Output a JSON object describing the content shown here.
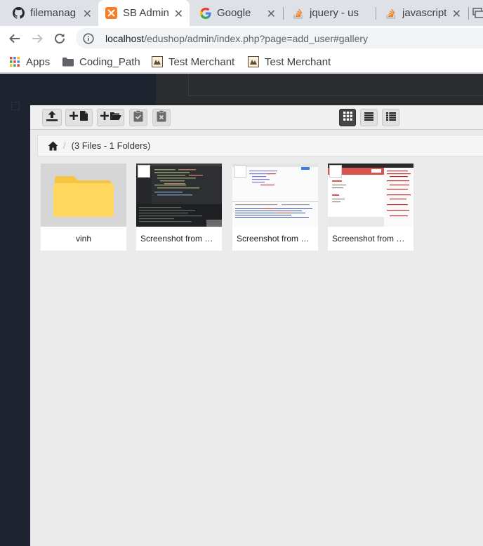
{
  "browser": {
    "tabs": [
      {
        "title": "filemanag",
        "icon": "github-icon",
        "active": false
      },
      {
        "title": "SB Admin",
        "icon": "xampp-icon",
        "active": true
      },
      {
        "title": "Google",
        "icon": "google-icon",
        "active": false
      },
      {
        "title": "jquery - us",
        "icon": "stackoverflow-icon",
        "active": false
      },
      {
        "title": "javascript",
        "icon": "stackoverflow-icon",
        "active": false
      }
    ],
    "close_glyph": "✕",
    "url_host": "localhost",
    "url_rest": "/edushop/admin/index.php?page=add_user#gallery"
  },
  "bookmarks": [
    {
      "label": "Apps",
      "icon": "apps-grid-icon"
    },
    {
      "label": "Coding_Path",
      "icon": "folder-icon"
    },
    {
      "label": "Test Merchant",
      "icon": "merchant-icon"
    },
    {
      "label": "Test Merchant",
      "icon": "merchant-icon"
    }
  ],
  "filemanager": {
    "toolbar": {
      "upload": "upload-icon",
      "new_file": "new-file-icon",
      "new_folder": "new-folder-icon",
      "paste": "paste-icon",
      "clear_clipboard": "clear-clipboard-icon",
      "view_boxes": "grid-view-icon",
      "view_list": "list-view-icon",
      "view_columns": "columns-view-icon"
    },
    "breadcrumb": {
      "separator": "/",
      "summary": "(3 Files - 1 Folders)"
    },
    "items": [
      {
        "type": "folder",
        "name": "vinh"
      },
      {
        "type": "image",
        "name": "Screenshot from 2…"
      },
      {
        "type": "image",
        "name": "Screenshot from 2…"
      },
      {
        "type": "image",
        "name": "Screenshot from 2…"
      }
    ]
  },
  "colors": {
    "sidebar": "#1d2430",
    "active_view_button": "#444444",
    "folder": "#ffd75e"
  }
}
